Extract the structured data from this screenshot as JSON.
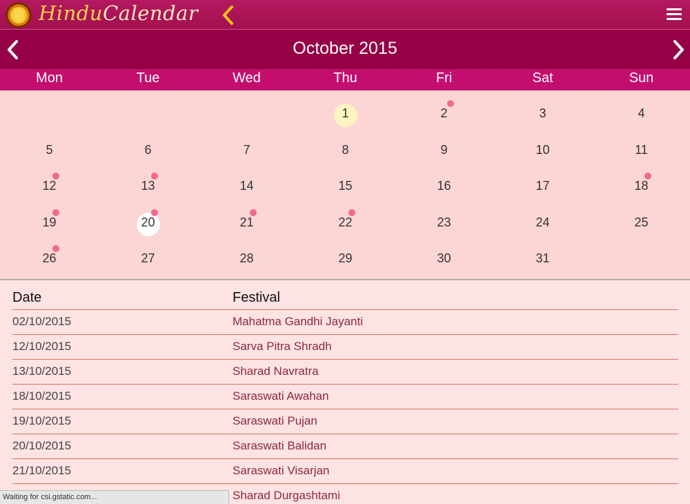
{
  "app": {
    "logo_word1": "Hindu",
    "logo_word2": "Calendar",
    "icons": [
      "ganesha-logo-icon",
      "chevron-left-icon",
      "hamburger-menu-icon"
    ]
  },
  "month": {
    "title": "October 2015",
    "prev_icon": "chevron-left-icon",
    "next_icon": "chevron-right-icon"
  },
  "weekdays": [
    "Mon",
    "Tue",
    "Wed",
    "Thu",
    "Fri",
    "Sat",
    "Sun"
  ],
  "calendar": {
    "first_weekday_col": 3,
    "days": [
      "1",
      "2",
      "3",
      "4",
      "5",
      "6",
      "7",
      "8",
      "9",
      "10",
      "11",
      "12",
      "13",
      "14",
      "15",
      "16",
      "17",
      "18",
      "19",
      "20",
      "21",
      "22",
      "23",
      "24",
      "25",
      "26",
      "27",
      "28",
      "29",
      "30",
      "31"
    ],
    "today": 1,
    "selected": 20,
    "event_days": [
      2,
      12,
      13,
      18,
      19,
      20,
      21,
      22,
      26
    ],
    "colors": {
      "event_dot": "#f06a8b",
      "today_bg": "#fdf4c0",
      "selected_bg": "#ffffff"
    }
  },
  "festivals": {
    "header_date": "Date",
    "header_festival": "Festival",
    "rows": [
      {
        "date": "02/10/2015",
        "name": "Mahatma Gandhi Jayanti"
      },
      {
        "date": "12/10/2015",
        "name": "Sarva Pitra Shradh"
      },
      {
        "date": "13/10/2015",
        "name": "Sharad Navratra"
      },
      {
        "date": "18/10/2015",
        "name": "Saraswati Awahan"
      },
      {
        "date": "19/10/2015",
        "name": "Saraswati Pujan"
      },
      {
        "date": "20/10/2015",
        "name": "Saraswati Balidan"
      },
      {
        "date": "21/10/2015",
        "name": "Saraswati Visarjan"
      },
      {
        "date": "",
        "name": "Sharad Durgashtami"
      }
    ]
  },
  "status": {
    "text": "Waiting for csi.gstatic.com..."
  },
  "colors": {
    "topbar": "#a3104f",
    "monthbar": "#960044",
    "weekdaybar": "#c40e6e",
    "grid_bg": "#fcd5d5",
    "list_bg": "#fde3e3",
    "logo_gold": "#f2d24a"
  }
}
